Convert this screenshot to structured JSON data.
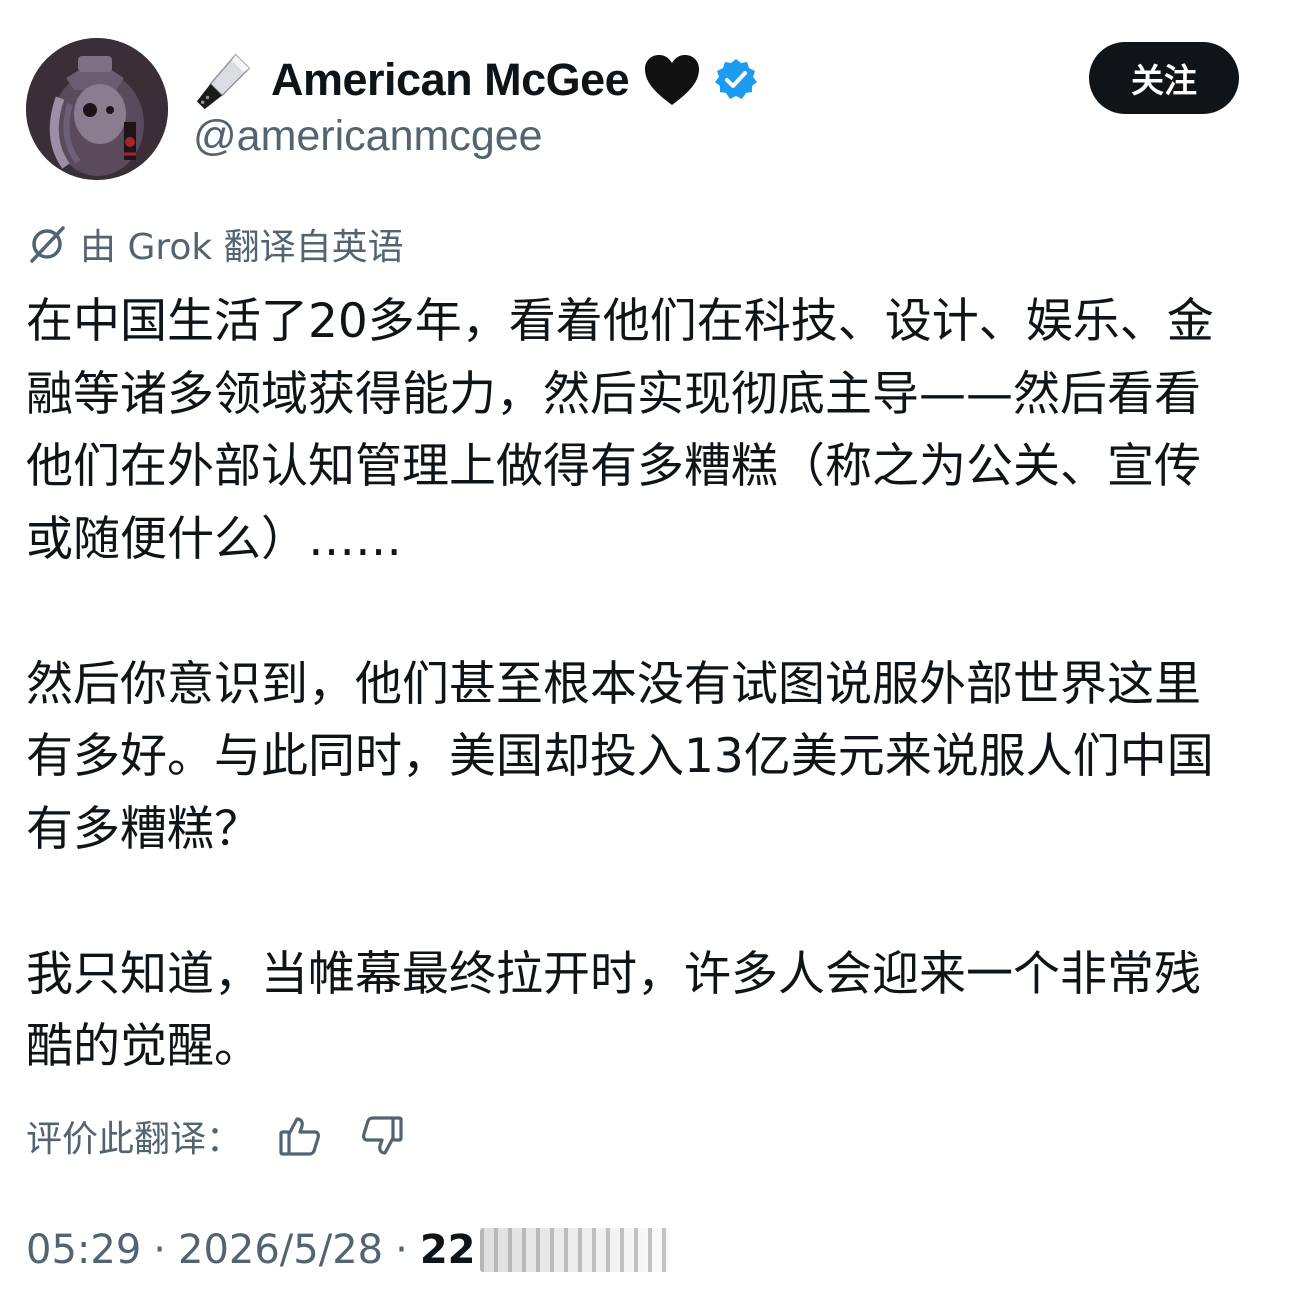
{
  "profile": {
    "display_name": "American McGee",
    "handle": "@americanmcgee",
    "prefix_icon": "kitchen-knife-icon",
    "suffix_icon": "black-heart-icon",
    "verified_icon": "verified-badge-icon",
    "verified_color": "#1d9bf0"
  },
  "follow_button": {
    "label": "关注",
    "background": "#0f1419",
    "text_color": "#ffffff"
  },
  "translation_notice": {
    "icon": "grok-icon",
    "text": "由 Grok 翻译自英语"
  },
  "tweet": {
    "paragraphs": [
      "在中国生活了20多年，看着他们在科技、设计、娱乐、金融等诸多领域获得能力，然后实现彻底主导——然后看看他们在外部认知管理上做得有多糟糕（称之为公关、宣传或随便什么）……",
      "然后你意识到，他们甚至根本没有试图说服外部世界这里有多好。与此同时，美国却投入13亿美元来说服人们中国有多糟糕？",
      "我只知道，当帷幕最终拉开时，许多人会迎来一个非常残酷的觉醒。"
    ]
  },
  "rate_translation": {
    "label": "评价此翻译：",
    "thumbs_up_icon": "thumbs-up-icon",
    "thumbs_down_icon": "thumbs-down-icon"
  },
  "meta": {
    "time": "05:29",
    "separator": "·",
    "date": "2026/5/28",
    "views_visible": "22"
  },
  "colors": {
    "text_primary": "#0f1419",
    "text_secondary": "#536471"
  }
}
